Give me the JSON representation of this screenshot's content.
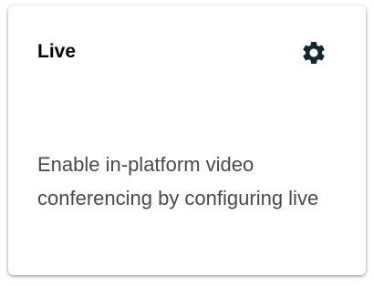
{
  "card": {
    "title": "Live",
    "description": "Enable in-platform video conferencing by configuring live",
    "settings_icon": "gear-icon",
    "icon_color": "#0f2a2e"
  }
}
